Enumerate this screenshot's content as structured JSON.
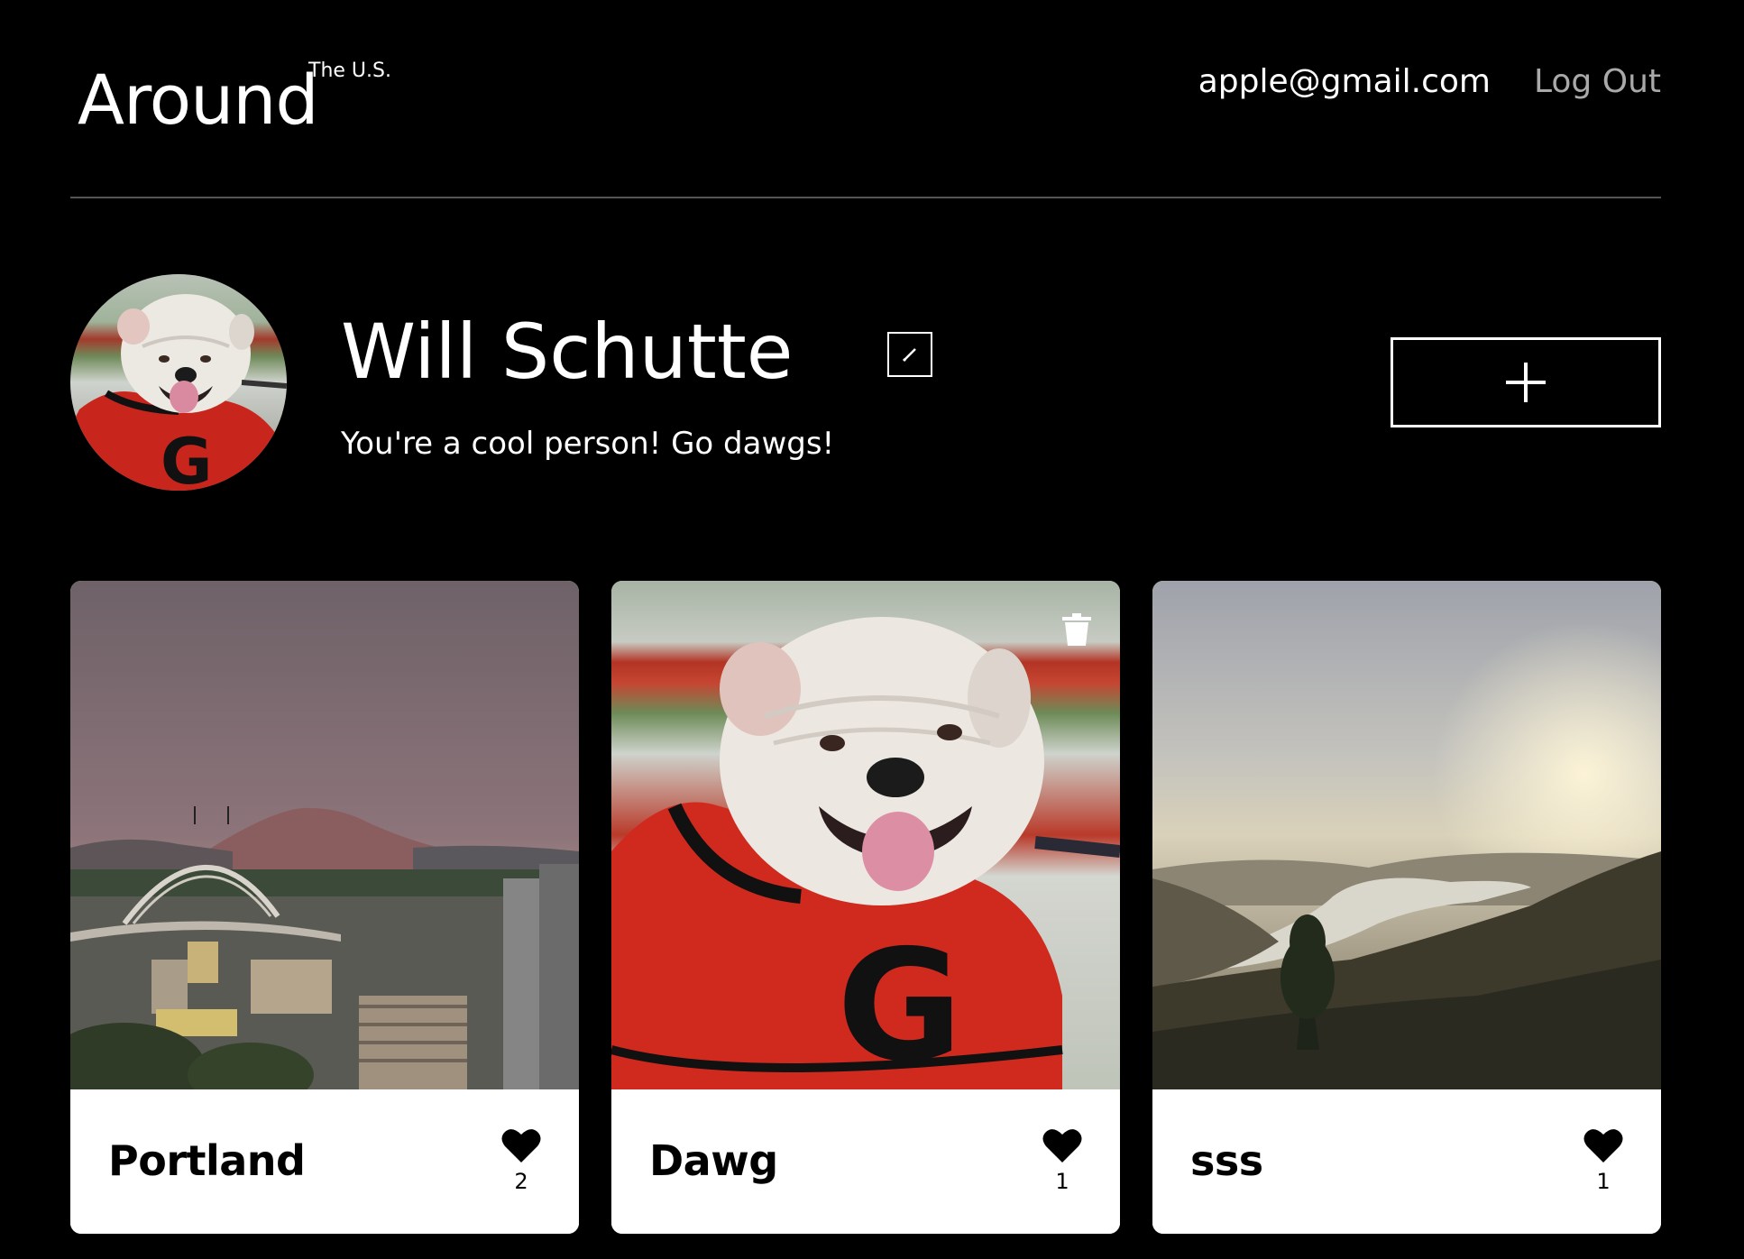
{
  "header": {
    "logo_main": "Around",
    "logo_sup": "The U.S.",
    "email": "apple@gmail.com",
    "logout_label": "Log Out"
  },
  "profile": {
    "name": "Will Schutte",
    "about": "You're a cool person! Go dawgs!",
    "edit_icon": "pencil-icon",
    "add_icon": "plus-icon"
  },
  "cards": [
    {
      "title": "Portland",
      "likes": "2",
      "deletable": false
    },
    {
      "title": "Dawg",
      "likes": "1",
      "deletable": true
    },
    {
      "title": "sss",
      "likes": "1",
      "deletable": false
    }
  ],
  "colors": {
    "background": "#000000",
    "divider": "#545454",
    "logout": "#a9a9a9",
    "card_footer": "#ffffff"
  }
}
